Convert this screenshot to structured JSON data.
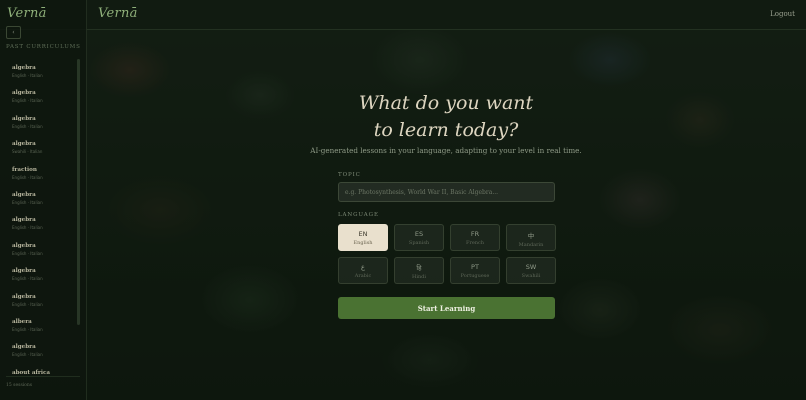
{
  "app": {
    "brand": "Vernā"
  },
  "header": {
    "logout_label": "Logout"
  },
  "sidebar": {
    "collapse_glyph": "‹",
    "section_label": "PAST CURRICULUMS",
    "items": [
      {
        "title": "algebra",
        "meta": "English · Italian"
      },
      {
        "title": "algebra",
        "meta": "English · Italian"
      },
      {
        "title": "algebra",
        "meta": "English · Italian"
      },
      {
        "title": "algebra",
        "meta": "Swahili · Italian"
      },
      {
        "title": "fraction",
        "meta": "English · Italian"
      },
      {
        "title": "algebra",
        "meta": "English · Italian"
      },
      {
        "title": "algebra",
        "meta": "English · Italian"
      },
      {
        "title": "algebra",
        "meta": "English · Italian"
      },
      {
        "title": "algebra",
        "meta": "English · Italian"
      },
      {
        "title": "algebra",
        "meta": "English · Italian"
      },
      {
        "title": "albera",
        "meta": "English · Italian"
      },
      {
        "title": "algebra",
        "meta": "English · Italian"
      },
      {
        "title": "about africa",
        "meta": "English · Italian"
      }
    ],
    "session_count": "15 sessions"
  },
  "hero": {
    "title_line1": "What do you want",
    "title_line2": "to learn today?",
    "subtitle": "AI-generated lessons in your language, adapting to your level in real time."
  },
  "topic": {
    "label": "TOPIC",
    "placeholder": "e.g. Photosynthesis, World War II, Basic Algebra..."
  },
  "language": {
    "label": "LANGUAGE",
    "options": [
      {
        "code": "EN",
        "name": "English",
        "active": true
      },
      {
        "code": "ES",
        "name": "Spanish",
        "active": false
      },
      {
        "code": "FR",
        "name": "French",
        "active": false
      },
      {
        "code": "中",
        "name": "Mandarin",
        "active": false
      },
      {
        "code": "ع",
        "name": "Arabic",
        "active": false
      },
      {
        "code": "हि",
        "name": "Hindi",
        "active": false
      },
      {
        "code": "PT",
        "name": "Portuguese",
        "active": false
      },
      {
        "code": "SW",
        "name": "Swahili",
        "active": false
      }
    ]
  },
  "cta": {
    "start_label": "Start Learning"
  },
  "colors": {
    "accent": "#4a7232",
    "brand": "#8fb07a",
    "active_chip": "#e9e0cd"
  }
}
